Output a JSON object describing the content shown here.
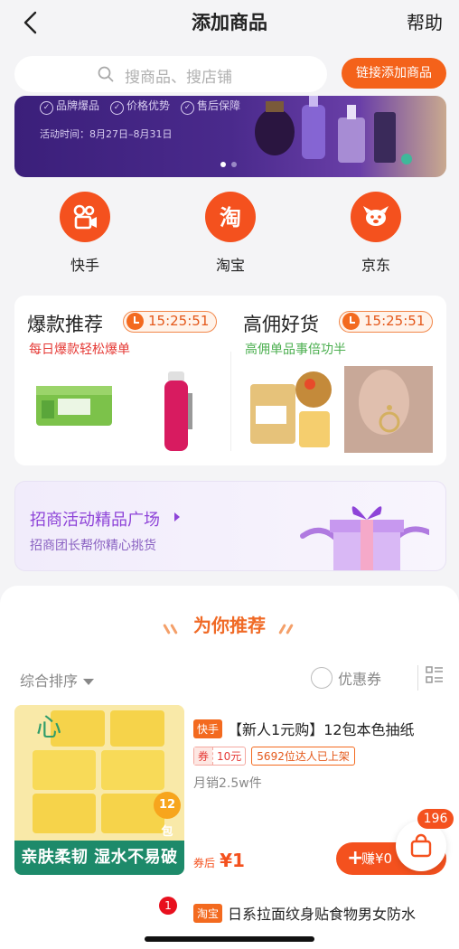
{
  "header": {
    "title": "添加商品",
    "help_label": "帮助"
  },
  "search": {
    "placeholder": "搜商品、搜店铺",
    "link_add_label": "链接添加商品"
  },
  "banner": {
    "tags": [
      "品牌爆品",
      "价格优势",
      "售后保障"
    ],
    "date": "活动时间：8月27日–8月31日",
    "active_slide": 1,
    "slide_count": 2
  },
  "platforms": [
    {
      "label": "快手",
      "icon": "kuaishou-icon"
    },
    {
      "label": "淘宝",
      "icon": "taobao-icon"
    },
    {
      "label": "京东",
      "icon": "jd-icon"
    }
  ],
  "promos": [
    {
      "title": "爆款推荐",
      "timer": "15:25:51",
      "subtitle": "每日爆款轻松爆单"
    },
    {
      "title": "高佣好货",
      "timer": "15:25:51",
      "subtitle": "高佣单品事倍功半"
    }
  ],
  "merchant": {
    "title": "招商活动精品广场",
    "subtitle": "招商团长帮你精心挑货"
  },
  "recommend": {
    "title": "为你推荐",
    "sort_label": "综合排序",
    "coupon_filter_label": "优惠券"
  },
  "product": {
    "platform_tag": "快手",
    "name": "【新人1元购】12包本色抽纸",
    "coupon_left": "券",
    "coupon_value": "10元",
    "kol_tag": "5692位达人已上架",
    "sales": "月销2.5w件",
    "price_prefix": "券后",
    "price": "¥1",
    "earn_label": "赚¥0",
    "image_caption": "亲肤柔韧 湿水不易破",
    "pack_badge": "12包"
  },
  "cart": {
    "count": "196"
  },
  "next_item": {
    "rank": "1",
    "platform_tag": "淘宝",
    "name": "日系拉面纹身贴食物男女防水"
  },
  "colors": {
    "accent": "#f4511e",
    "purple": "#8e44d8",
    "green_caption": "#1d8a6a"
  }
}
